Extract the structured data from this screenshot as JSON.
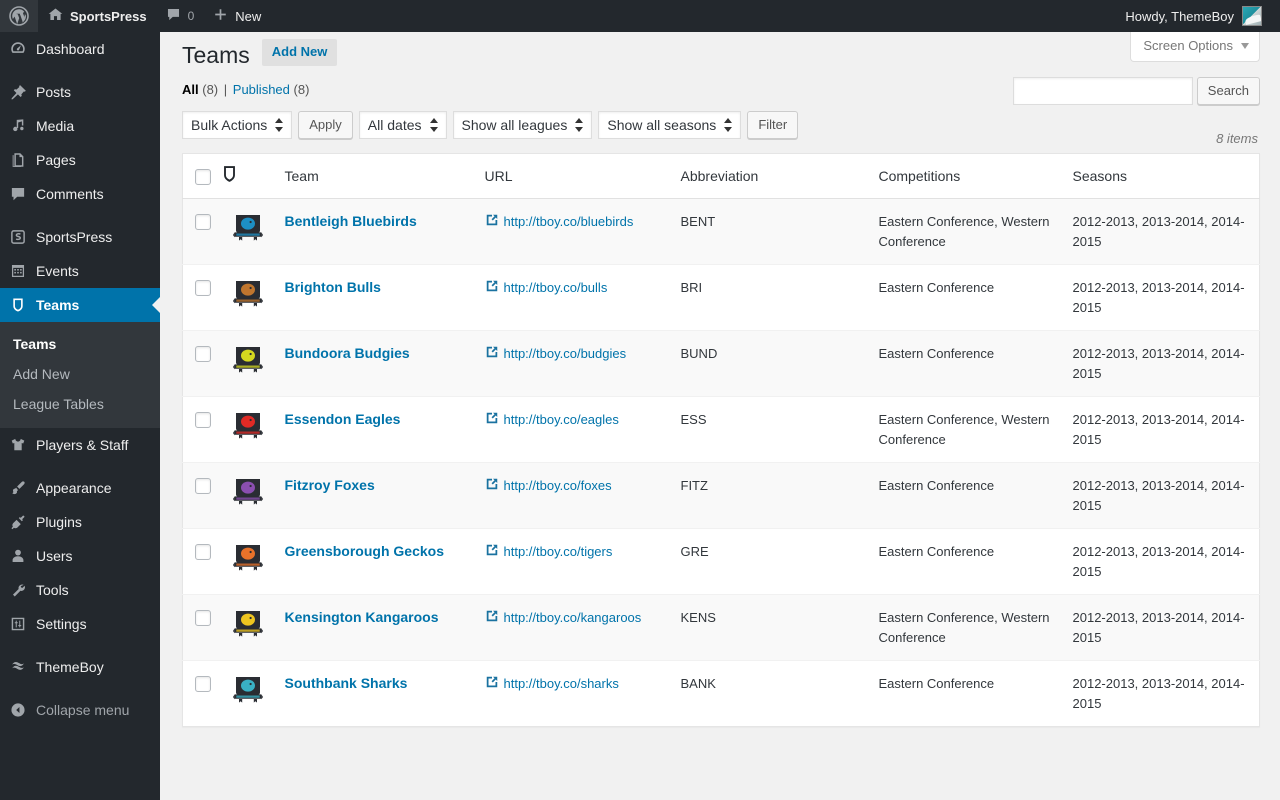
{
  "adminbar": {
    "wp_logo_icon": "wordpress-logo-icon",
    "site_icon": "home-icon",
    "site_name": "SportsPress",
    "comments_icon": "comment-bubble-icon",
    "comments_count": "0",
    "new_icon": "plus-icon",
    "new_label": "New",
    "howdy": "Howdy, ThemeBoy",
    "avatar_name": "user-avatar"
  },
  "sidebar": {
    "items": [
      {
        "label": "Dashboard",
        "icon": "dashboard-icon",
        "current": false,
        "sep_after": true
      },
      {
        "label": "Posts",
        "icon": "pin-icon",
        "current": false,
        "sep_after": false
      },
      {
        "label": "Media",
        "icon": "media-icon",
        "current": false,
        "sep_after": false
      },
      {
        "label": "Pages",
        "icon": "pages-icon",
        "current": false,
        "sep_after": false
      },
      {
        "label": "Comments",
        "icon": "comment-bubble-icon",
        "current": false,
        "sep_after": true
      },
      {
        "label": "SportsPress",
        "icon": "sportspress-icon",
        "current": false,
        "sep_after": false
      },
      {
        "label": "Events",
        "icon": "calendar-icon",
        "current": false,
        "sep_after": false
      },
      {
        "label": "Teams",
        "icon": "shield-icon",
        "current": true,
        "sep_after": false
      }
    ],
    "submenu": [
      {
        "label": "Teams",
        "current": true
      },
      {
        "label": "Add New",
        "current": false
      },
      {
        "label": "League Tables",
        "current": false
      }
    ],
    "items_after": [
      {
        "label": "Players & Staff",
        "icon": "jersey-icon",
        "current": false,
        "sep_after": true
      },
      {
        "label": "Appearance",
        "icon": "paintbrush-icon",
        "current": false,
        "sep_after": false
      },
      {
        "label": "Plugins",
        "icon": "plug-icon",
        "current": false,
        "sep_after": false
      },
      {
        "label": "Users",
        "icon": "user-icon",
        "current": false,
        "sep_after": false
      },
      {
        "label": "Tools",
        "icon": "wrench-icon",
        "current": false,
        "sep_after": false
      },
      {
        "label": "Settings",
        "icon": "sliders-icon",
        "current": false,
        "sep_after": true
      },
      {
        "label": "ThemeBoy",
        "icon": "themeboy-icon",
        "current": false,
        "sep_after": false
      }
    ],
    "collapse": {
      "label": "Collapse menu",
      "icon": "collapse-arrow-icon"
    }
  },
  "screen_options": {
    "label": "Screen Options",
    "caret_icon": "chevron-down-icon"
  },
  "page": {
    "title": "Teams",
    "add_new_label": "Add New"
  },
  "views": {
    "all_label": "All",
    "all_count": "(8)",
    "separator": "|",
    "published_label": "Published",
    "published_count": "(8)"
  },
  "search": {
    "value": "",
    "placeholder": "",
    "button_label": "Search"
  },
  "filters": {
    "bulk_actions": "Bulk Actions",
    "apply_label": "Apply",
    "dates": "All dates",
    "leagues": "Show all leagues",
    "seasons": "Show all seasons",
    "filter_label": "Filter",
    "displaying_num": "8 items"
  },
  "table": {
    "columns": {
      "checkbox": "select-all",
      "logo": "shield-icon",
      "team": "Team",
      "url": "URL",
      "abbreviation": "Abbreviation",
      "competitions": "Competitions",
      "seasons": "Seasons"
    },
    "rows": [
      {
        "logo_name": "bluebirds-crest-icon",
        "logo_colors": {
          "primary": "#1d8fc4",
          "secondary": "#2a2d33"
        },
        "team": "Bentleigh Bluebirds",
        "url": "http://tboy.co/bluebirds",
        "abbreviation": "BENT",
        "competitions": "Eastern Conference, Western Conference",
        "seasons": "2012-2013, 2013-2014, 2014-2015"
      },
      {
        "logo_name": "bulls-crest-icon",
        "logo_colors": {
          "primary": "#c0762e",
          "secondary": "#2a2d33"
        },
        "team": "Brighton Bulls",
        "url": "http://tboy.co/bulls",
        "abbreviation": "BRI",
        "competitions": "Eastern Conference",
        "seasons": "2012-2013, 2013-2014, 2014-2015"
      },
      {
        "logo_name": "budgies-crest-icon",
        "logo_colors": {
          "primary": "#d4d820",
          "secondary": "#2a2d33"
        },
        "team": "Bundoora Budgies",
        "url": "http://tboy.co/budgies",
        "abbreviation": "BUND",
        "competitions": "Eastern Conference",
        "seasons": "2012-2013, 2013-2014, 2014-2015"
      },
      {
        "logo_name": "eagles-crest-icon",
        "logo_colors": {
          "primary": "#e02a26",
          "secondary": "#2a2d33"
        },
        "team": "Essendon Eagles",
        "url": "http://tboy.co/eagles",
        "abbreviation": "ESS",
        "competitions": "Eastern Conference, Western Conference",
        "seasons": "2012-2013, 2013-2014, 2014-2015"
      },
      {
        "logo_name": "foxes-crest-icon",
        "logo_colors": {
          "primary": "#8b4fb0",
          "secondary": "#2a2d33"
        },
        "team": "Fitzroy Foxes",
        "url": "http://tboy.co/foxes",
        "abbreviation": "FITZ",
        "competitions": "Eastern Conference",
        "seasons": "2012-2013, 2013-2014, 2014-2015"
      },
      {
        "logo_name": "geckos-crest-icon",
        "logo_colors": {
          "primary": "#e8722a",
          "secondary": "#2a2d33"
        },
        "team": "Greensborough Geckos",
        "url": "http://tboy.co/tigers",
        "abbreviation": "GRE",
        "competitions": "Eastern Conference",
        "seasons": "2012-2013, 2013-2014, 2014-2015"
      },
      {
        "logo_name": "kangaroos-crest-icon",
        "logo_colors": {
          "primary": "#efc520",
          "secondary": "#2a2d33"
        },
        "team": "Kensington Kangaroos",
        "url": "http://tboy.co/kangaroos",
        "abbreviation": "KENS",
        "competitions": "Eastern Conference, Western Conference",
        "seasons": "2012-2013, 2013-2014, 2014-2015"
      },
      {
        "logo_name": "sharks-crest-icon",
        "logo_colors": {
          "primary": "#3ab0c4",
          "secondary": "#2a2d33"
        },
        "team": "Southbank Sharks",
        "url": "http://tboy.co/sharks",
        "abbreviation": "BANK",
        "competitions": "Eastern Conference",
        "seasons": "2012-2013, 2013-2014, 2014-2015"
      }
    ]
  },
  "colors": {
    "admin_bar": "#23282d",
    "sidebar": "#23282d",
    "submenu": "#32373c",
    "accent": "#0073aa",
    "link": "#0073aa",
    "content_bg": "#f1f1f1",
    "row_alt": "#f9f9f9"
  }
}
